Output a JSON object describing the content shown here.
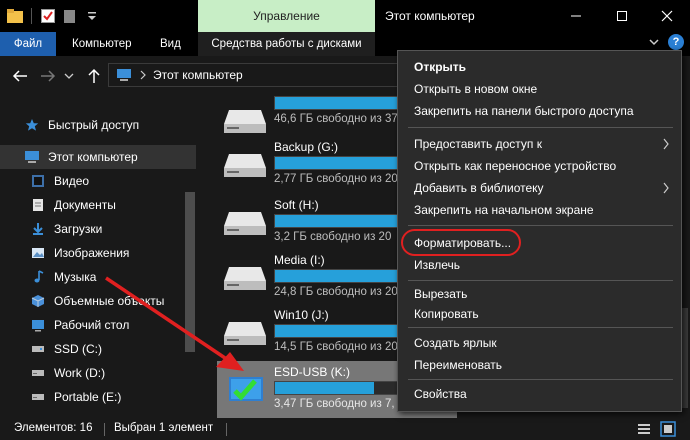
{
  "titlebar": {
    "manage_tab": "Управление",
    "window_title": "Этот компьютер"
  },
  "ribbon": {
    "tabs": [
      "Файл",
      "Компьютер",
      "Вид",
      "Средства работы с дисками"
    ]
  },
  "address": {
    "path": "Этот компьютер"
  },
  "sidebar": {
    "items": [
      {
        "label": "Быстрый доступ",
        "icon": "star-icon"
      },
      {
        "label": "Этот компьютер",
        "icon": "computer-icon"
      },
      {
        "label": "Видео",
        "icon": "video-icon"
      },
      {
        "label": "Документы",
        "icon": "documents-icon"
      },
      {
        "label": "Загрузки",
        "icon": "downloads-icon"
      },
      {
        "label": "Изображения",
        "icon": "images-icon"
      },
      {
        "label": "Музыка",
        "icon": "music-icon"
      },
      {
        "label": "Объемные объекты",
        "icon": "3d-objects-icon"
      },
      {
        "label": "Рабочий стол",
        "icon": "desktop-icon"
      },
      {
        "label": "SSD (C:)",
        "icon": "drive-icon"
      },
      {
        "label": "Work (D:)",
        "icon": "drive-icon"
      },
      {
        "label": "Portable (E:)",
        "icon": "drive-icon"
      }
    ]
  },
  "drives": [
    {
      "name": "",
      "free": "46,6 ГБ свободно из 37",
      "usage": 0.88
    },
    {
      "name": "Backup (G:)",
      "free": "2,77 ГБ свободно из 20",
      "usage": 0.98
    },
    {
      "name": "Soft (H:)",
      "free": "3,2 ГБ свободно из 20",
      "usage": 0.97
    },
    {
      "name": "Media (I:)",
      "free": "24,8 ГБ свободно из 20",
      "usage": 0.9
    },
    {
      "name": "Win10 (J:)",
      "free": "14,5 ГБ свободно из 20",
      "usage": 0.93
    },
    {
      "name": "ESD-USB (K:)",
      "free": "3,47 ГБ свободно из 7,",
      "usage": 0.54
    }
  ],
  "context_menu": {
    "items": [
      {
        "label": "Открыть",
        "bold": true
      },
      {
        "label": "Открыть в новом окне"
      },
      {
        "label": "Закрепить на панели быстрого доступа"
      },
      {
        "label": "Предоставить доступ к",
        "submenu": true
      },
      {
        "label": "Открыть как переносное устройство"
      },
      {
        "label": "Добавить в библиотеку",
        "submenu": true
      },
      {
        "label": "Закрепить на начальном экране"
      },
      {
        "label": "Форматировать..."
      },
      {
        "label": "Извлечь"
      },
      {
        "label": "Вырезать"
      },
      {
        "label": "Копировать"
      },
      {
        "label": "Создать ярлык"
      },
      {
        "label": "Переименовать"
      },
      {
        "label": "Свойства"
      }
    ]
  },
  "status": {
    "count": "Элементов: 16",
    "selected": "Выбран 1 элемент"
  },
  "colors": {
    "accent": "#26a0da",
    "file_tab": "#1e5fae",
    "manage_tab": "#c8eec6",
    "annotation_red": "#e02020"
  }
}
